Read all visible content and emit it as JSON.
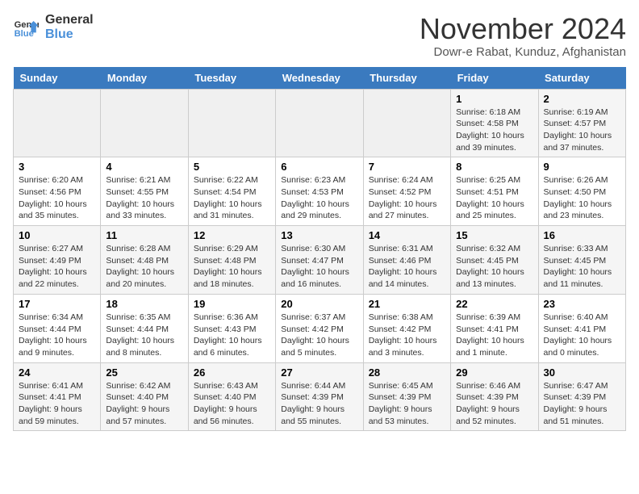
{
  "logo": {
    "line1": "General",
    "line2": "Blue"
  },
  "title": "November 2024",
  "subtitle": "Dowr-e Rabat, Kunduz, Afghanistan",
  "days_of_week": [
    "Sunday",
    "Monday",
    "Tuesday",
    "Wednesday",
    "Thursday",
    "Friday",
    "Saturday"
  ],
  "weeks": [
    [
      {
        "day": "",
        "info": ""
      },
      {
        "day": "",
        "info": ""
      },
      {
        "day": "",
        "info": ""
      },
      {
        "day": "",
        "info": ""
      },
      {
        "day": "",
        "info": ""
      },
      {
        "day": "1",
        "info": "Sunrise: 6:18 AM\nSunset: 4:58 PM\nDaylight: 10 hours and 39 minutes."
      },
      {
        "day": "2",
        "info": "Sunrise: 6:19 AM\nSunset: 4:57 PM\nDaylight: 10 hours and 37 minutes."
      }
    ],
    [
      {
        "day": "3",
        "info": "Sunrise: 6:20 AM\nSunset: 4:56 PM\nDaylight: 10 hours and 35 minutes."
      },
      {
        "day": "4",
        "info": "Sunrise: 6:21 AM\nSunset: 4:55 PM\nDaylight: 10 hours and 33 minutes."
      },
      {
        "day": "5",
        "info": "Sunrise: 6:22 AM\nSunset: 4:54 PM\nDaylight: 10 hours and 31 minutes."
      },
      {
        "day": "6",
        "info": "Sunrise: 6:23 AM\nSunset: 4:53 PM\nDaylight: 10 hours and 29 minutes."
      },
      {
        "day": "7",
        "info": "Sunrise: 6:24 AM\nSunset: 4:52 PM\nDaylight: 10 hours and 27 minutes."
      },
      {
        "day": "8",
        "info": "Sunrise: 6:25 AM\nSunset: 4:51 PM\nDaylight: 10 hours and 25 minutes."
      },
      {
        "day": "9",
        "info": "Sunrise: 6:26 AM\nSunset: 4:50 PM\nDaylight: 10 hours and 23 minutes."
      }
    ],
    [
      {
        "day": "10",
        "info": "Sunrise: 6:27 AM\nSunset: 4:49 PM\nDaylight: 10 hours and 22 minutes."
      },
      {
        "day": "11",
        "info": "Sunrise: 6:28 AM\nSunset: 4:48 PM\nDaylight: 10 hours and 20 minutes."
      },
      {
        "day": "12",
        "info": "Sunrise: 6:29 AM\nSunset: 4:48 PM\nDaylight: 10 hours and 18 minutes."
      },
      {
        "day": "13",
        "info": "Sunrise: 6:30 AM\nSunset: 4:47 PM\nDaylight: 10 hours and 16 minutes."
      },
      {
        "day": "14",
        "info": "Sunrise: 6:31 AM\nSunset: 4:46 PM\nDaylight: 10 hours and 14 minutes."
      },
      {
        "day": "15",
        "info": "Sunrise: 6:32 AM\nSunset: 4:45 PM\nDaylight: 10 hours and 13 minutes."
      },
      {
        "day": "16",
        "info": "Sunrise: 6:33 AM\nSunset: 4:45 PM\nDaylight: 10 hours and 11 minutes."
      }
    ],
    [
      {
        "day": "17",
        "info": "Sunrise: 6:34 AM\nSunset: 4:44 PM\nDaylight: 10 hours and 9 minutes."
      },
      {
        "day": "18",
        "info": "Sunrise: 6:35 AM\nSunset: 4:44 PM\nDaylight: 10 hours and 8 minutes."
      },
      {
        "day": "19",
        "info": "Sunrise: 6:36 AM\nSunset: 4:43 PM\nDaylight: 10 hours and 6 minutes."
      },
      {
        "day": "20",
        "info": "Sunrise: 6:37 AM\nSunset: 4:42 PM\nDaylight: 10 hours and 5 minutes."
      },
      {
        "day": "21",
        "info": "Sunrise: 6:38 AM\nSunset: 4:42 PM\nDaylight: 10 hours and 3 minutes."
      },
      {
        "day": "22",
        "info": "Sunrise: 6:39 AM\nSunset: 4:41 PM\nDaylight: 10 hours and 1 minute."
      },
      {
        "day": "23",
        "info": "Sunrise: 6:40 AM\nSunset: 4:41 PM\nDaylight: 10 hours and 0 minutes."
      }
    ],
    [
      {
        "day": "24",
        "info": "Sunrise: 6:41 AM\nSunset: 4:41 PM\nDaylight: 9 hours and 59 minutes."
      },
      {
        "day": "25",
        "info": "Sunrise: 6:42 AM\nSunset: 4:40 PM\nDaylight: 9 hours and 57 minutes."
      },
      {
        "day": "26",
        "info": "Sunrise: 6:43 AM\nSunset: 4:40 PM\nDaylight: 9 hours and 56 minutes."
      },
      {
        "day": "27",
        "info": "Sunrise: 6:44 AM\nSunset: 4:39 PM\nDaylight: 9 hours and 55 minutes."
      },
      {
        "day": "28",
        "info": "Sunrise: 6:45 AM\nSunset: 4:39 PM\nDaylight: 9 hours and 53 minutes."
      },
      {
        "day": "29",
        "info": "Sunrise: 6:46 AM\nSunset: 4:39 PM\nDaylight: 9 hours and 52 minutes."
      },
      {
        "day": "30",
        "info": "Sunrise: 6:47 AM\nSunset: 4:39 PM\nDaylight: 9 hours and 51 minutes."
      }
    ]
  ]
}
